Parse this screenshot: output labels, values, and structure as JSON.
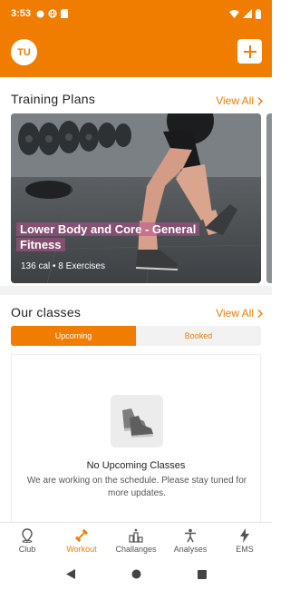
{
  "status_bar": {
    "time": "3:53"
  },
  "header": {
    "avatar_initials": "TU"
  },
  "training_plans": {
    "title": "Training Plans",
    "view_all": "View All",
    "card": {
      "title": "Lower Body and Core - General Fitness",
      "meta": "136 cal • 8 Exercises"
    }
  },
  "classes": {
    "title": "Our classes",
    "view_all": "View All",
    "tabs": [
      {
        "label": "Upcoming",
        "active": true
      },
      {
        "label": "Booked",
        "active": false
      }
    ],
    "empty": {
      "title": "No Upcoming Classes",
      "subtitle": "We are working on the schedule. Please stay tuned for more updates."
    }
  },
  "bottom_nav": {
    "items": [
      {
        "label": "Club",
        "icon": "location-pin-icon"
      },
      {
        "label": "Workout",
        "icon": "dumbbell-icon"
      },
      {
        "label": "Challanges",
        "icon": "podium-icon"
      },
      {
        "label": "Analyses",
        "icon": "person-icon"
      },
      {
        "label": "EMS",
        "icon": "lightning-icon"
      }
    ]
  },
  "colors": {
    "accent": "#f07c00"
  }
}
